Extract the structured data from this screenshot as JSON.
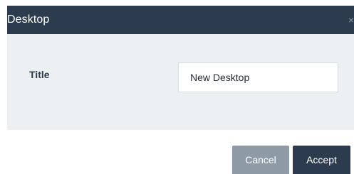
{
  "dialog": {
    "title": "Desktop",
    "close_icon": "close-icon",
    "field": {
      "label": "Title",
      "value": "New Desktop"
    },
    "buttons": {
      "cancel_label": "Cancel",
      "accept_label": "Accept"
    }
  },
  "colors": {
    "header_bg": "#2d3b4e",
    "body_bg": "#edf0f3",
    "cancel_bg": "#8e9ba6",
    "accept_bg": "#2d3b4e"
  }
}
